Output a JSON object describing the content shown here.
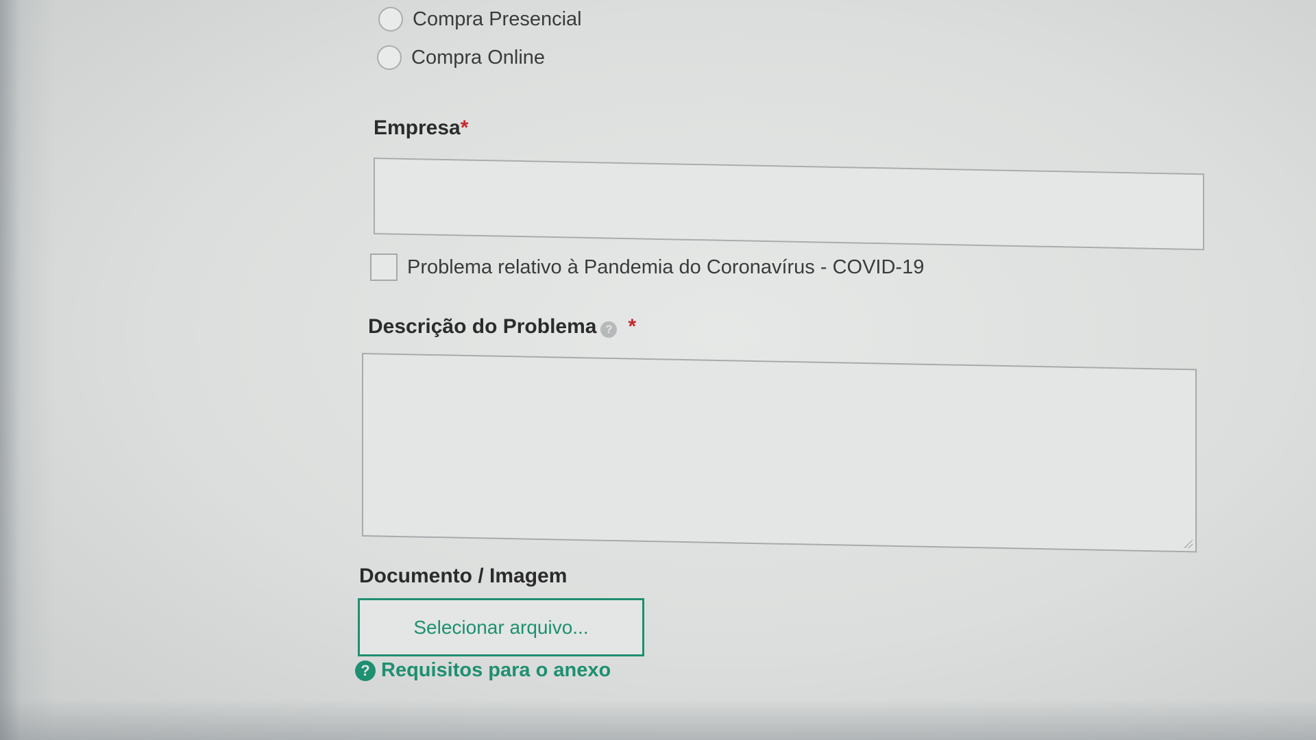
{
  "purchase_type": {
    "options": [
      {
        "label": "Compra Presencial",
        "selected": false
      },
      {
        "label": "Compra Online",
        "selected": false
      }
    ]
  },
  "empresa": {
    "label": "Empresa",
    "required_mark": "*",
    "value": ""
  },
  "covid": {
    "label": "Problema relativo à Pandemia do Coronavírus - COVID-19",
    "checked": false
  },
  "descricao": {
    "label": "Descrição do Problema",
    "help_icon": "?",
    "required_mark": "*",
    "value": ""
  },
  "documento": {
    "label": "Documento / Imagem",
    "button_label": "Selecionar arquivo...",
    "help_icon": "?",
    "requirements_link": "Requisitos para o anexo"
  },
  "colors": {
    "accent": "#1e8f70",
    "required": "#c9262c"
  }
}
